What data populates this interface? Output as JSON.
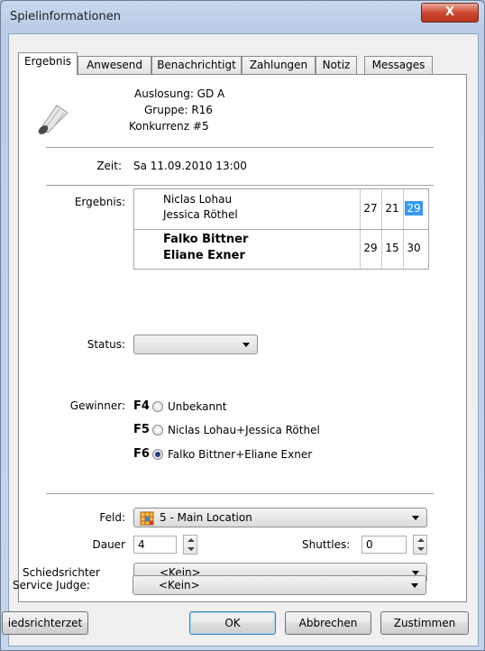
{
  "window": {
    "title": "Spielinformationen",
    "close_label": "X"
  },
  "tabs": [
    {
      "label": "Ergebnis",
      "active": true
    },
    {
      "label": "Anwesend"
    },
    {
      "label": "Benachrichtigt"
    },
    {
      "label": "Zahlungen"
    },
    {
      "label": "Notiz"
    },
    {
      "label": "Messages"
    }
  ],
  "match_info": {
    "auslosung": "Auslosung: GD A",
    "gruppe": "Gruppe: R16",
    "konkurrenz": "Konkurrenz #5",
    "icon": "shuttlecock-icon"
  },
  "zeit": {
    "label": "Zeit:",
    "value": "Sa 11.09.2010 13:00"
  },
  "ergebnis": {
    "label": "Ergebnis:",
    "team1": {
      "player1": "Niclas Lohau",
      "player2": "Jessica Röthel",
      "scores": [
        "27",
        "21",
        "29"
      ]
    },
    "team2": {
      "player1": "Falko Bittner",
      "player2": "Eliane Exner",
      "scores": [
        "29",
        "15",
        "30"
      ]
    }
  },
  "status": {
    "label": "Status:",
    "value": ""
  },
  "gewinner": {
    "label": "Gewinner:",
    "options": [
      {
        "key": "F4",
        "text": "Unbekannt",
        "selected": false
      },
      {
        "key": "F5",
        "text": "Niclas Lohau+Jessica Röthel",
        "selected": false
      },
      {
        "key": "F6",
        "text": "Falko Bittner+Eliane Exner",
        "selected": true
      }
    ]
  },
  "feld": {
    "label": "Feld:",
    "value": "5 - Main Location",
    "icon": "court-grid-icon"
  },
  "dauer": {
    "label": "Dauer",
    "value": "4"
  },
  "shuttles": {
    "label": "Shuttles:",
    "value": "0"
  },
  "schiedsrichter": {
    "label": "Schiedsrichter",
    "value": "<Kein>"
  },
  "service_judge": {
    "label": "Service Judge:",
    "value": "<Kein>"
  },
  "buttons": {
    "schiedsrichterzettel": "iedsrichterzet",
    "ok": "OK",
    "abbrechen": "Abbrechen",
    "zustimmen": "Zustimmen"
  },
  "colors": {
    "selection": "#3399ff",
    "title_bar": "#b9cde6",
    "close_button": "#cf4a32"
  }
}
